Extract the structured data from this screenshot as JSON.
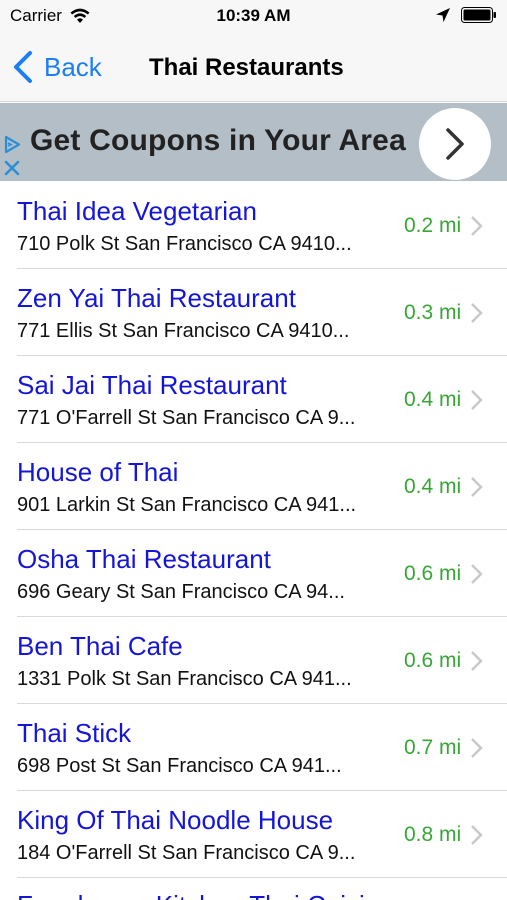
{
  "status_bar": {
    "carrier": "Carrier",
    "time": "10:39 AM",
    "icons": [
      "wifi-icon",
      "location-arrow-icon",
      "battery-icon"
    ]
  },
  "nav": {
    "back_label": "Back",
    "title": "Thai Restaurants",
    "accent_color": "#1a7ef5"
  },
  "ad": {
    "text": "Get Coupons in Your Area",
    "background": "#b4bec6"
  },
  "restaurants": [
    {
      "name": "Thai Idea Vegetarian",
      "address": "710 Polk St San Francisco CA 9410...",
      "distance": "0.2 mi"
    },
    {
      "name": "Zen Yai Thai Restaurant",
      "address": "771 Ellis St San Francisco CA 9410...",
      "distance": "0.3 mi"
    },
    {
      "name": "Sai Jai Thai Restaurant",
      "address": "771 O'Farrell St San Francisco CA 9...",
      "distance": "0.4 mi"
    },
    {
      "name": "House of Thai",
      "address": "901 Larkin St San Francisco CA 941...",
      "distance": "0.4 mi"
    },
    {
      "name": "Osha Thai Restaurant",
      "address": "696 Geary St San Francisco CA 94...",
      "distance": "0.6 mi"
    },
    {
      "name": "Ben Thai Cafe",
      "address": "1331 Polk St San Francisco CA 941...",
      "distance": "0.6 mi"
    },
    {
      "name": "Thai Stick",
      "address": "698 Post St San Francisco CA 941...",
      "distance": "0.7 mi"
    },
    {
      "name": "King Of Thai Noodle House",
      "address": "184 O'Farrell St San Francisco CA 9...",
      "distance": "0.8 mi"
    }
  ],
  "partial_row": {
    "name": "Farmhouse Kitchen Thai Cuisine"
  },
  "colors": {
    "name": "#1515d8",
    "distance": "#36a634"
  }
}
